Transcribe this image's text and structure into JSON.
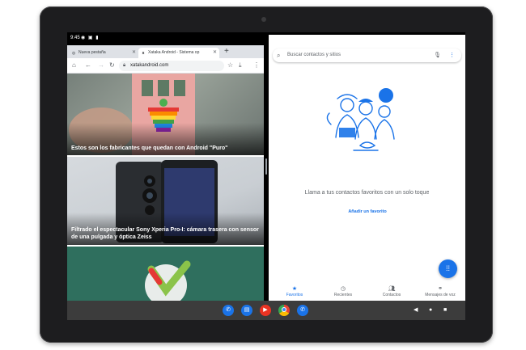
{
  "status_bar": {
    "time": "9:45"
  },
  "chrome": {
    "tabs": [
      {
        "label": "Nueva pestaña"
      },
      {
        "label": "Xataka Android - Sistema op"
      }
    ],
    "url": "xatakandroid.com",
    "articles": [
      {
        "title": "Estos son los fabricantes que quedan con Android \"Puro\""
      },
      {
        "title": "Filtrado el espectacular Sony Xperia Pro-I: cámara trasera con sensor de una pulgada y óptica Zeiss"
      },
      {
        "title": ""
      }
    ]
  },
  "contacts": {
    "search_placeholder": "Buscar contactos y sitios",
    "empty_text": "Llama a tus contactos favoritos con un solo toque",
    "add_favorite": "Añadir un favorito",
    "nav": [
      {
        "label": "Favoritos",
        "icon": "star-icon",
        "active": true
      },
      {
        "label": "Recientes",
        "icon": "clock-icon",
        "active": false
      },
      {
        "label": "Contactos",
        "icon": "people-icon",
        "active": false
      },
      {
        "label": "Mensajes de voz",
        "icon": "voicemail-icon",
        "active": false
      }
    ]
  },
  "taskbar": {
    "apps": [
      {
        "icon": "phone-app-icon",
        "color": "#1a73e8"
      },
      {
        "icon": "messages-app-icon",
        "color": "#1a73e8"
      },
      {
        "icon": "youtube-app-icon",
        "color": "#ea3323"
      },
      {
        "icon": "chrome-app-icon",
        "color": "#34a853"
      },
      {
        "icon": "dialer-app-icon",
        "color": "#1a73e8"
      }
    ]
  },
  "colors": {
    "accent": "#1a73e8",
    "taskbar": "#3c3c3c",
    "bezel": "#1d1d1f"
  }
}
